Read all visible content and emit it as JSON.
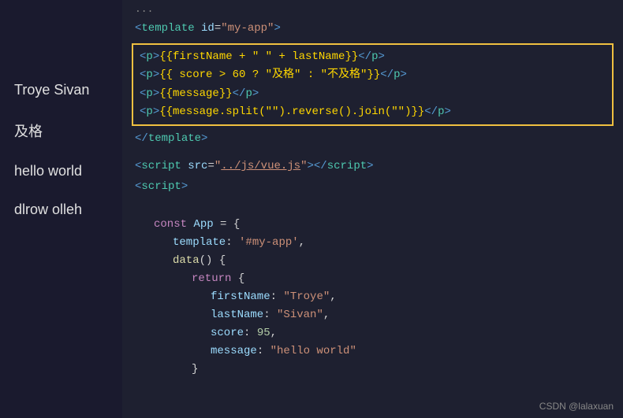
{
  "left_panel": {
    "items": [
      {
        "id": "item-troye-sivan",
        "text": "Troye Sivan"
      },
      {
        "id": "item-pass",
        "text": "及格"
      },
      {
        "id": "item-hello-world",
        "text": "hello world"
      },
      {
        "id": "item-dlrow-olleh",
        "text": "dlrow olleh"
      }
    ]
  },
  "code": {
    "top_comment": "...",
    "template_open": "<template id=\"my-app\">",
    "highlighted_lines": [
      "  <p>{{firstName + \" \" + lastName}}</p>",
      "  <p>{{ score > 60 ? \"及格\" : \"不及格\"}}</p>",
      "  <p>{{message}}</p>",
      "  <p>{{message.split(\"\").reverse().join(\"\")}}</p>"
    ],
    "template_close": "</template>",
    "script_src": "<script src=\"../js/vue.js\"><\\/script>",
    "script_open": "<script>",
    "const_line": "    const App = {",
    "template_prop": "        template: '#my-app',",
    "data_func": "        data() {",
    "return_open": "            return {",
    "firstname": "                firstName: \"Troye\",",
    "lastname": "                lastName: \"Sivan\",",
    "score": "                score: 95,",
    "message": "                message: \"hello world\"",
    "return_close": "            }",
    "watermark": "CSDN @lalaxuan"
  }
}
